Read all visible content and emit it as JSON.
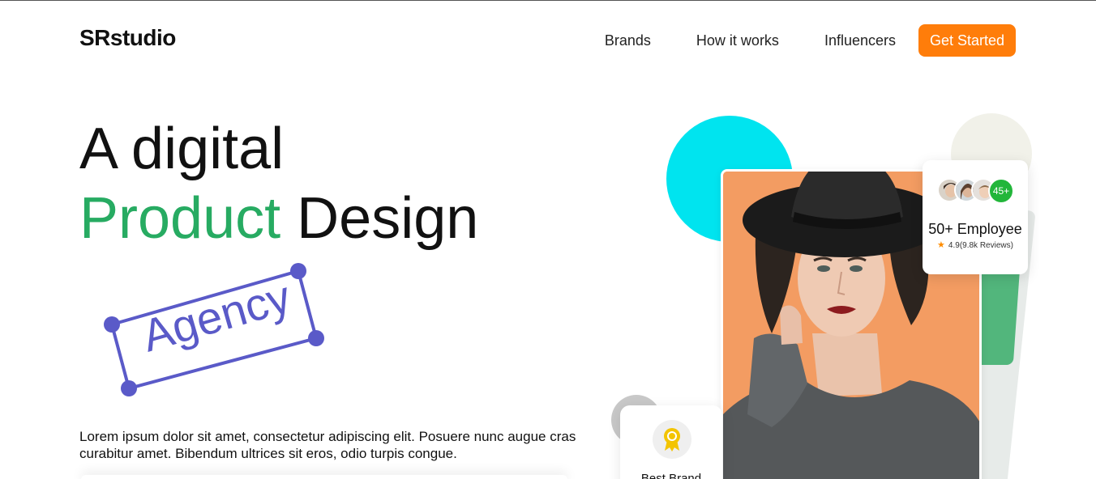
{
  "header": {
    "logo": "SRstudio",
    "nav": [
      "Brands",
      "How it works",
      "Influencers"
    ],
    "cta_label": "Get Started",
    "cta_color": "#ff7d0a"
  },
  "hero": {
    "title_line1": "A digital",
    "title_highlight": "Product",
    "title_rest": "Design",
    "highlight_color": "#27ab62",
    "badge_text": "Agency",
    "badge_color": "#5a5ac8",
    "description": "Lorem ipsum dolor sit amet, consectetur adipiscing elit. Posuere nunc augue cras curabitur amet. Bibendum ultrices sit eros, odio turpis congue."
  },
  "employee_card": {
    "avatar_count": "45+",
    "title": "50+ Employee",
    "rating": "4.9(9.8k Reviews)",
    "star_icon": "star-icon"
  },
  "brand_card": {
    "icon": "award-ribbon-icon",
    "label": "Best Brand"
  },
  "colors": {
    "cyan": "#00e4ef",
    "green": "#52b67c",
    "photo_bg": "#f39c62"
  }
}
